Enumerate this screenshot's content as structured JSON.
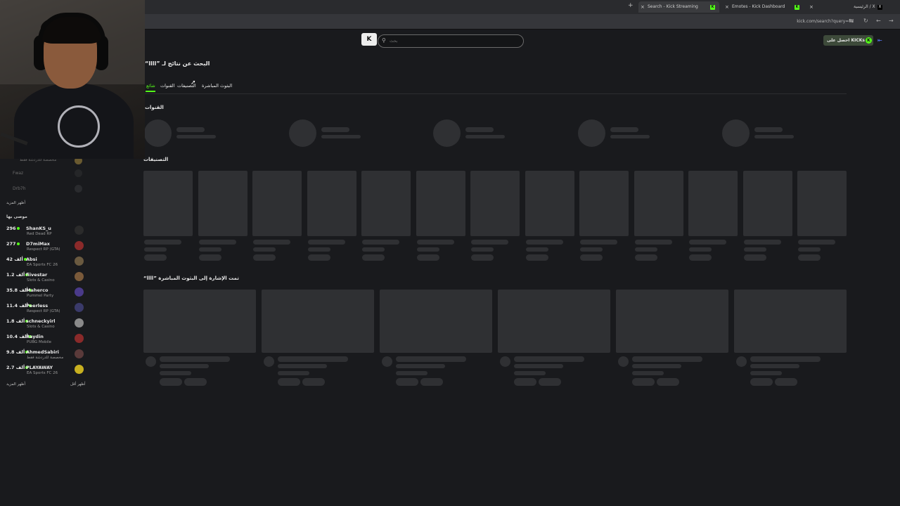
{
  "browser": {
    "tabs": [
      {
        "title": "Search - Kick Streaming",
        "active": true
      },
      {
        "title": "Emotes - Kick Dashboard",
        "active": false
      },
      {
        "title": "الرئيسية / X",
        "active": false
      }
    ],
    "url": "kick.com/search?query=llll"
  },
  "header": {
    "search_placeholder": "بحث",
    "get_kicks_label": "احصل على KICKs",
    "logo_text": "K"
  },
  "sidebar": {
    "followed": [
      {
        "name": "مخصصة للدردشة فقط"
      },
      {
        "name": "Fwaz"
      },
      {
        "name": "Drb7h"
      }
    ],
    "show_more_label": "أظهر المزيد",
    "recommended_title": "موصى بها",
    "recommended": [
      {
        "name": "ShanKS_u",
        "viewers": "296",
        "category": "Red Dead RP",
        "color": "#2b2b2b"
      },
      {
        "name": "D7miMax",
        "viewers": "277",
        "category": "Respect RP (GTA)",
        "color": "#8b2a2a"
      },
      {
        "name": "Absi",
        "viewers": "42 ألف",
        "category": "EA Sports FC 26",
        "color": "#6a5a40"
      },
      {
        "name": "fiivestar",
        "viewers": "1.2 ألف",
        "category": "Slots & Casino",
        "color": "#7a5a3a"
      },
      {
        "name": "Maherco",
        "viewers": "35.8 ألف",
        "category": "Pummel Party",
        "color": "#4a3a8a"
      },
      {
        "name": "Peerless",
        "viewers": "11.4 ألف",
        "category": "Respect RP (GTA)",
        "color": "#3a3a6a"
      },
      {
        "name": "schneckyirl",
        "viewers": "1.8 ألف",
        "category": "Slots & Casino",
        "color": "#8a8a8a"
      },
      {
        "name": "Raydin",
        "viewers": "10.4 ألف",
        "category": "PUBG Mobile",
        "color": "#8a2a2a"
      },
      {
        "name": "AhmedSabiri",
        "viewers": "9.8 ألف",
        "category": "مخصصة للدردشة فقط",
        "color": "#5a3a3a"
      },
      {
        "name": "PLAYAWAY",
        "viewers": "2.7 ألف",
        "category": "EA Sports FC 26",
        "color": "#c8b020"
      }
    ],
    "show_more_bottom": "أظهر المزيد",
    "show_less_bottom": "أظهر أقل"
  },
  "main": {
    "title": "“llll” البحث عن نتائج لـ",
    "tabs": {
      "all": "شائع",
      "channels": "القنوات",
      "categories": "التصنيفات",
      "live": "البثوث المباشرة"
    },
    "section_channels": "القنوات",
    "section_categories": "التصنيفات",
    "section_tagged": "“llll” تمت الإشارة إلى البثوث المباشرة"
  },
  "colors": {
    "accent": "#53fc18",
    "background": "#191a1d",
    "skeleton": "#2f3033"
  }
}
